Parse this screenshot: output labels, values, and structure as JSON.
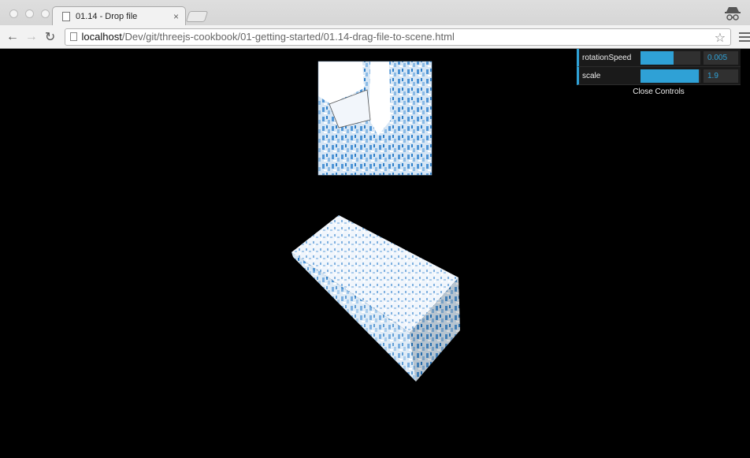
{
  "browser": {
    "tab_title": "01.14 - Drop file",
    "tab_close": "×",
    "url_host": "localhost",
    "url_path": "/Dev/git/threejs-cookbook/01-getting-started/01.14-drag-file-to-scene.html",
    "icons": {
      "back": "back-arrow-icon",
      "forward": "forward-arrow-icon",
      "reload": "reload-icon",
      "star": "star-icon",
      "menu": "menu-icon",
      "profile": "incognito-profile-icon"
    }
  },
  "gui": {
    "controls": [
      {
        "label": "rotationSpeed",
        "value": "0.005",
        "fill": 0.55
      },
      {
        "label": "scale",
        "value": "1.9",
        "fill": 0.98
      }
    ],
    "close_label": "Close Controls",
    "accent": "#2fa1d6"
  },
  "scene": {
    "background": "#000000",
    "texture_colors": [
      "#ffffff",
      "#cfe0f2",
      "#6fa8dc",
      "#2e7fc9"
    ]
  }
}
